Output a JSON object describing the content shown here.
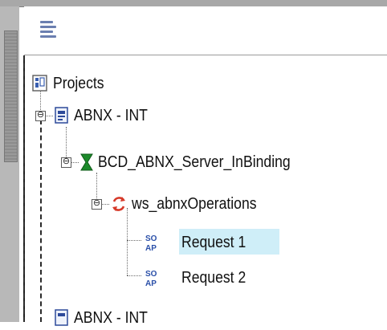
{
  "tree": {
    "root_label": "Projects",
    "project_label": "ABNX - INT",
    "binding_label": "BCD_ABNX_Server_InBinding",
    "operation_label": "ws_abnxOperations",
    "requests": [
      "Request 1",
      "Request 2"
    ],
    "next_project_label": "ABNX - INT",
    "expanders": [
      "⊖",
      "⊖",
      "⊖"
    ],
    "soap_icon_text": "SO AP"
  },
  "colors": {
    "selection": "#cfeef8",
    "binding_icon": "#1c8a2a",
    "operation_icon": "#d63a2a",
    "soap_icon": "#2a4fa8"
  }
}
